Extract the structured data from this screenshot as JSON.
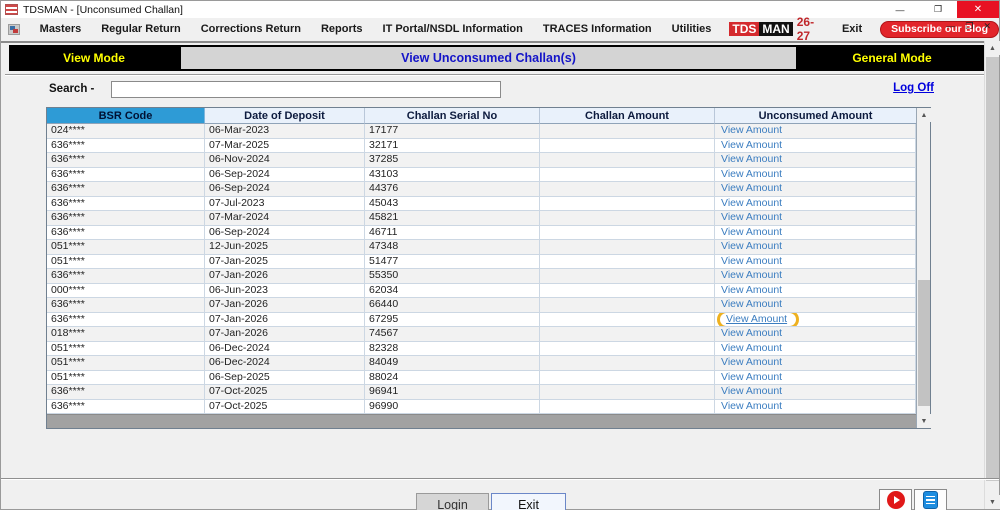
{
  "window": {
    "title": "TDSMAN - [Unconsumed Challan]",
    "minimize": "—",
    "restore": "❐",
    "close": "✕"
  },
  "menu": {
    "items": [
      "Masters",
      "Regular Return",
      "Corrections Return",
      "Reports",
      "IT Portal/NSDL Information",
      "TRACES Information",
      "Utilities"
    ],
    "logo": {
      "tds": "TDS",
      "man": "MAN",
      "year": "26-27"
    },
    "exit_label": "Exit",
    "subscribe_label": "Subscribe our Blog"
  },
  "modebar": {
    "left_label": "View Mode",
    "center_title": "View Unconsumed Challan(s)",
    "right_label": "General Mode"
  },
  "toolbar": {
    "search_label": "Search -",
    "search_value": "",
    "logoff_label": "Log Off"
  },
  "table": {
    "headers": [
      "BSR Code",
      "Date of Deposit",
      "Challan Serial No",
      "Challan Amount",
      "Unconsumed Amount"
    ],
    "link_label": "View Amount",
    "rows": [
      {
        "bsr": "024****",
        "date": "06-Mar-2023",
        "serial": "17177",
        "amount": "",
        "highlight": false
      },
      {
        "bsr": "636****",
        "date": "07-Mar-2025",
        "serial": "32171",
        "amount": "",
        "highlight": false
      },
      {
        "bsr": "636****",
        "date": "06-Nov-2024",
        "serial": "37285",
        "amount": "",
        "highlight": false
      },
      {
        "bsr": "636****",
        "date": "06-Sep-2024",
        "serial": "43103",
        "amount": "",
        "highlight": false
      },
      {
        "bsr": "636****",
        "date": "06-Sep-2024",
        "serial": "44376",
        "amount": "",
        "highlight": false
      },
      {
        "bsr": "636****",
        "date": "07-Jul-2023",
        "serial": "45043",
        "amount": "",
        "highlight": false
      },
      {
        "bsr": "636****",
        "date": "07-Mar-2024",
        "serial": "45821",
        "amount": "",
        "highlight": false
      },
      {
        "bsr": "636****",
        "date": "06-Sep-2024",
        "serial": "46711",
        "amount": "",
        "highlight": false
      },
      {
        "bsr": "051****",
        "date": "12-Jun-2025",
        "serial": "47348",
        "amount": "",
        "highlight": false
      },
      {
        "bsr": "051****",
        "date": "07-Jan-2025",
        "serial": "51477",
        "amount": "",
        "highlight": false
      },
      {
        "bsr": "636****",
        "date": "07-Jan-2026",
        "serial": "55350",
        "amount": "",
        "highlight": false
      },
      {
        "bsr": "000****",
        "date": "06-Jun-2023",
        "serial": "62034",
        "amount": "",
        "highlight": false
      },
      {
        "bsr": "636****",
        "date": "07-Jan-2026",
        "serial": "66440",
        "amount": "",
        "highlight": false
      },
      {
        "bsr": "636****",
        "date": "07-Jan-2026",
        "serial": "67295",
        "amount": "",
        "highlight": true
      },
      {
        "bsr": "018****",
        "date": "07-Jan-2026",
        "serial": "74567",
        "amount": "",
        "highlight": false
      },
      {
        "bsr": "051****",
        "date": "06-Dec-2024",
        "serial": "82328",
        "amount": "",
        "highlight": false
      },
      {
        "bsr": "051****",
        "date": "06-Dec-2024",
        "serial": "84049",
        "amount": "",
        "highlight": false
      },
      {
        "bsr": "051****",
        "date": "06-Sep-2025",
        "serial": "88024",
        "amount": "",
        "highlight": false
      },
      {
        "bsr": "636****",
        "date": "07-Oct-2025",
        "serial": "96941",
        "amount": "",
        "highlight": false
      },
      {
        "bsr": "636****",
        "date": "07-Oct-2025",
        "serial": "96990",
        "amount": "",
        "highlight": false
      }
    ]
  },
  "footer": {
    "login_label": "Login",
    "exit_label": "Exit"
  },
  "colors": {
    "header_selected": "#2e9bd6",
    "header_bg": "#e9f1fb",
    "link": "#3b7dc0",
    "highlight_ring": "#eeb120",
    "mode_text": "#ffff00",
    "close_red": "#e81123",
    "brand_red": "#d42a2e"
  }
}
